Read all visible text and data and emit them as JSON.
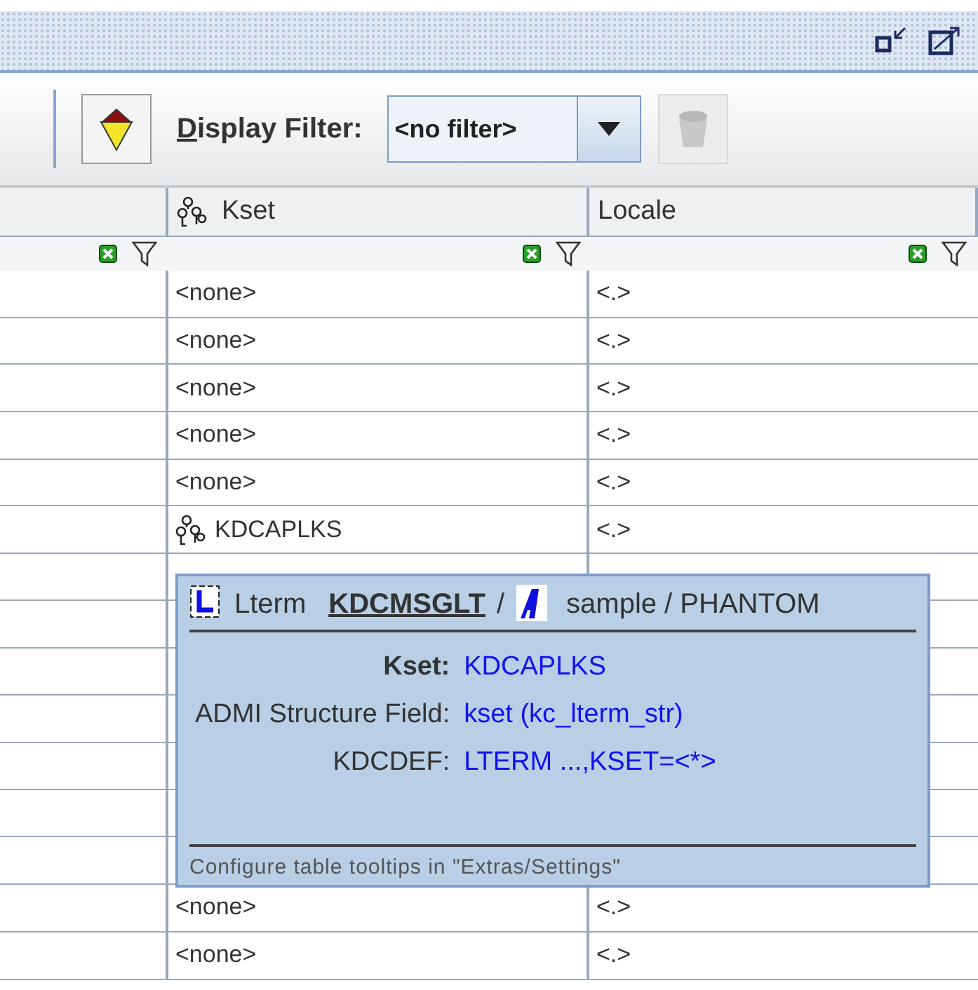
{
  "toolbar": {
    "filter_label": "Display Filter:",
    "filter_value": "<no filter>",
    "clear_button": {
      "disabled": true
    }
  },
  "columns": [
    {
      "kind": "blank"
    },
    {
      "kind": "kset",
      "label": "Kset"
    },
    {
      "kind": "plain",
      "label": "Locale"
    }
  ],
  "rows_above": [
    {
      "kind": "none",
      "kset": "<none>",
      "locale": "<.>"
    },
    {
      "kind": "none",
      "kset": "<none>",
      "locale": "<.>"
    },
    {
      "kind": "none",
      "kset": "<none>",
      "locale": "<.>"
    },
    {
      "kind": "none",
      "kset": "<none>",
      "locale": "<.>"
    },
    {
      "kind": "none",
      "kset": "<none>",
      "locale": "<.>"
    },
    {
      "kind": "kset",
      "kset": "KDCAPLKS",
      "locale": "<.>"
    }
  ],
  "tooltip": {
    "type": "Lterm",
    "name": "KDCMSGLT",
    "separator": "/",
    "application": "sample / PHANTOM",
    "fields": [
      {
        "label": "Kset:",
        "value": "KDCAPLKS",
        "bold": true
      },
      {
        "label": "ADMI Structure Field:",
        "value": "kset (kc_lterm_str)",
        "bold": false
      },
      {
        "label": "KDCDEF:",
        "value": "LTERM ...,KSET=<*>",
        "bold": false
      }
    ],
    "footer": "Configure table tooltips in \"Extras/Settings\""
  },
  "rows_below": [
    {
      "kset": "<none>",
      "locale": "<.>"
    },
    {
      "kset": "<none>",
      "locale": "<.>"
    }
  ]
}
